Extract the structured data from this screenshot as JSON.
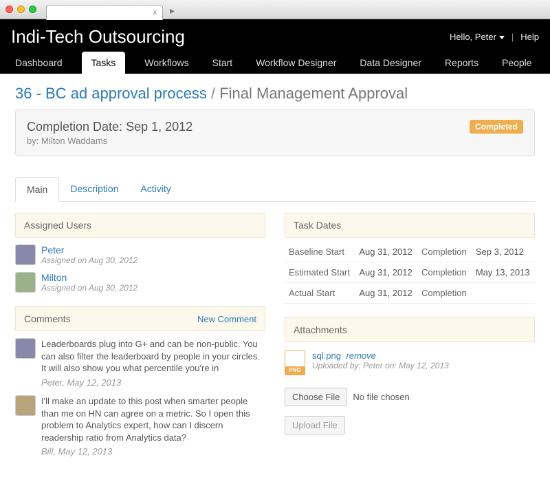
{
  "browser": {
    "close_x": "x",
    "new_tab": "▸"
  },
  "header": {
    "brand": "Indi-Tech Outsourcing",
    "greeting": "Hello, Peter",
    "help": "Help"
  },
  "nav": {
    "items": [
      "Dashboard",
      "Tasks",
      "Workflows",
      "Start",
      "Workflow Designer",
      "Data Designer",
      "Reports",
      "People"
    ],
    "active_index": 1
  },
  "breadcrumb": {
    "link": "36 - BC ad approval process",
    "sep": "/",
    "current": "Final Management Approval"
  },
  "summary": {
    "completion_label": "Completion Date:",
    "completion_value": "Sep 1, 2012",
    "by_prefix": "by:",
    "by_name": "Milton Waddams",
    "badge": "Completed"
  },
  "tabs": {
    "items": [
      "Main",
      "Description",
      "Activity"
    ],
    "active_index": 0
  },
  "panels": {
    "assigned_users": "Assigned Users",
    "task_dates": "Task Dates",
    "comments": "Comments",
    "new_comment": "New Comment",
    "attachments": "Attachments"
  },
  "assigned": [
    {
      "name": "Peter",
      "meta": "Assigned on Aug 30, 2012"
    },
    {
      "name": "Milton",
      "meta": "Assigned on Aug 30, 2012"
    }
  ],
  "dates": {
    "rows": [
      {
        "label": "Baseline Start",
        "start": "Aug 31, 2012",
        "clabel": "Completion",
        "end": "Sep 3, 2012"
      },
      {
        "label": "Estimated Start",
        "start": "Aug 31, 2012",
        "clabel": "Completion",
        "end": "May 13, 2013"
      },
      {
        "label": "Actual Start",
        "start": "Aug 31, 2012",
        "clabel": "Completion",
        "end": ""
      }
    ]
  },
  "comments": [
    {
      "text": "Leaderboards plug into G+ and can be non-public. You can also filter the leaderboard by people in your circles. It will also show you what percentile you're in",
      "meta": "Peter, May 12, 2013"
    },
    {
      "text": "I'll make an update to this post when smarter people than me on HN can agree on a metric. So I open this problem to Analytics expert, how can I discern readership ratio from Analytics data?",
      "meta": "Bill, May 12, 2013"
    }
  ],
  "attachment": {
    "icon_label": "PNG",
    "filename": "sql.png",
    "remove": "remove",
    "meta": "Uploaded by: Peter on: May 12, 2013"
  },
  "file_input": {
    "choose": "Choose File",
    "none": "No file chosen",
    "upload": "Upload File"
  }
}
